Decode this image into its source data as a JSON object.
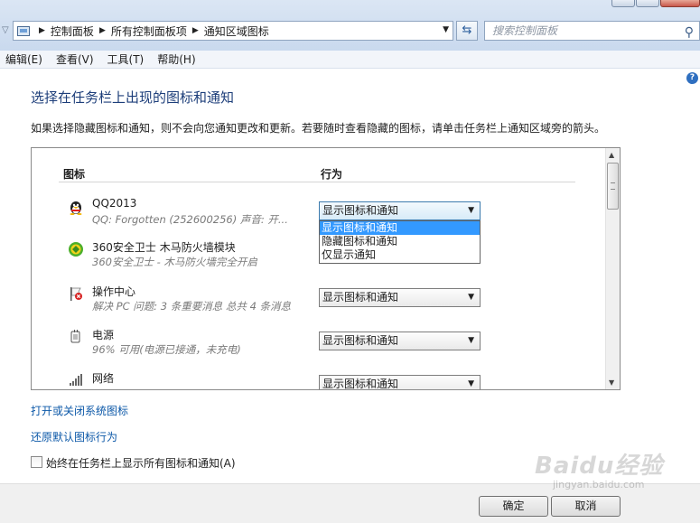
{
  "address_bar": {
    "crumbs": [
      "控制面板",
      "所有控制面板项",
      "通知区域图标"
    ],
    "search_placeholder": "搜索控制面板"
  },
  "menu": [
    "编辑(E)",
    "查看(V)",
    "工具(T)",
    "帮助(H)"
  ],
  "page": {
    "title": "选择在任务栏上出现的图标和通知",
    "description": "如果选择隐藏图标和通知，则不会向您通知更改和更新。若要随时查看隐藏的图标，请单击任务栏上通知区域旁的箭头。"
  },
  "list": {
    "col_icon": "图标",
    "col_behavior": "行为",
    "rows": [
      {
        "name": "QQ2013",
        "desc": "QQ:  Forgotten        (252600256)  声音: 开...",
        "behavior": "显示图标和通知",
        "icon": "qq-penguin-icon"
      },
      {
        "name": "360安全卫士 木马防火墙模块",
        "desc": "360安全卫士 - 木马防火墙完全开启",
        "behavior": "",
        "icon": "360-shield-icon"
      },
      {
        "name": "操作中心",
        "desc": "解决 PC 问题: 3 条重要消息 总共 4 条消息",
        "behavior": "显示图标和通知",
        "icon": "action-center-flag-icon"
      },
      {
        "name": "电源",
        "desc": "96% 可用(电源已接通，未充电)",
        "behavior": "显示图标和通知",
        "icon": "power-plug-icon"
      },
      {
        "name": "网络",
        "desc": "",
        "behavior": "显示图标和通知",
        "icon": "network-bars-icon"
      }
    ],
    "dropdown_options": [
      "显示图标和通知",
      "隐藏图标和通知",
      "仅显示通知"
    ],
    "dropdown_selected_index": 0
  },
  "links": {
    "system_icons": "打开或关闭系统图标",
    "restore_defaults": "还原默认图标行为"
  },
  "always_show": {
    "label": "始终在任务栏上显示所有图标和通知(A)",
    "checked": false
  },
  "buttons": {
    "ok": "确定",
    "cancel": "取消"
  },
  "watermark": {
    "text": "Baidu经验",
    "sub": "jingyan.baidu.com"
  }
}
